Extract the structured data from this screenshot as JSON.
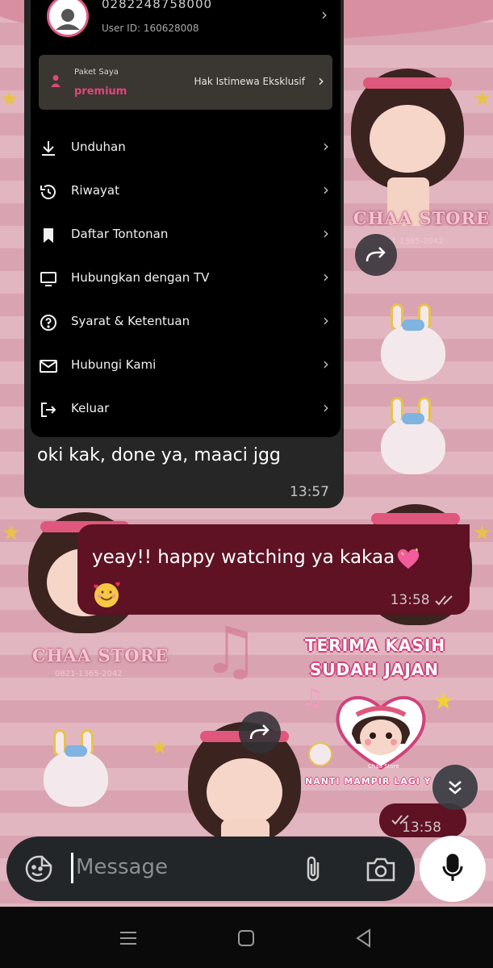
{
  "embedded_screen": {
    "phone_number": "0282248758000",
    "user_id": "User ID: 160628008",
    "plan": {
      "label": "Paket Saya",
      "value": "premium",
      "privilege": "Hak Istimewa Eksklusif"
    },
    "menu": [
      {
        "label": "Unduhan",
        "icon": "download-icon"
      },
      {
        "label": "Riwayat",
        "icon": "history-icon"
      },
      {
        "label": "Daftar Tontonan",
        "icon": "bookmark-icon"
      },
      {
        "label": "Hubungkan dengan TV",
        "icon": "tv-icon"
      },
      {
        "label": "Syarat & Ketentuan",
        "icon": "help-icon"
      },
      {
        "label": "Hubungi Kami",
        "icon": "mail-icon"
      },
      {
        "label": "Keluar",
        "icon": "logout-icon"
      }
    ]
  },
  "incoming_message": {
    "text": "oki kak, done ya, maaci jgg",
    "time": "13:57"
  },
  "outgoing_message": {
    "text": "yeay!! happy watching ya kakaa",
    "time": "13:58",
    "status": "read"
  },
  "sticker": {
    "line1": "TERIMA KASIH",
    "line2": "SUDAH JAJAN",
    "caption": "Chaa Store",
    "bottom": "NANTI MAMPIR LAGI Y",
    "time": "13:58"
  },
  "wallpaper": {
    "logo": "CHAA STORE",
    "phone": "0821-1365-2042"
  },
  "composer": {
    "placeholder": "Message"
  },
  "colors": {
    "outgoing_bubble": "#5e1224",
    "incoming_bubble": "#262626",
    "accent_pink": "#e0477a"
  }
}
